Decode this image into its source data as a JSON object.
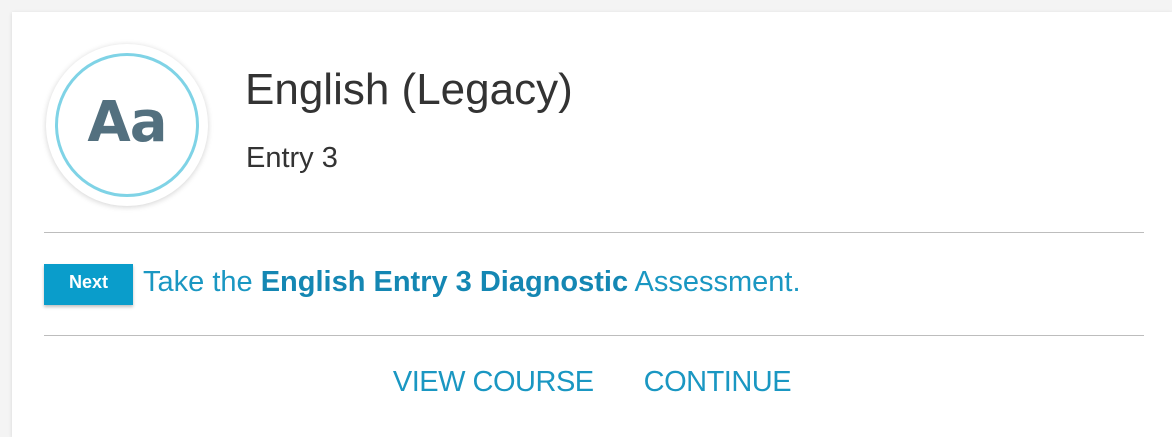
{
  "course": {
    "icon_label": "Aa",
    "icon_name": "aa-text-icon",
    "title": "English (Legacy)",
    "level": "Entry 3"
  },
  "next_step": {
    "badge": "Next",
    "prefix": "Take the ",
    "highlight": "English Entry 3 Diagnostic",
    "suffix": " Assessment."
  },
  "actions": {
    "view_course": "VIEW COURSE",
    "continue": "CONTINUE"
  },
  "colors": {
    "accent": "#0a9dcb",
    "link": "#1a97c2",
    "icon_ring": "#7fd3e6",
    "icon_text": "#53707f"
  }
}
